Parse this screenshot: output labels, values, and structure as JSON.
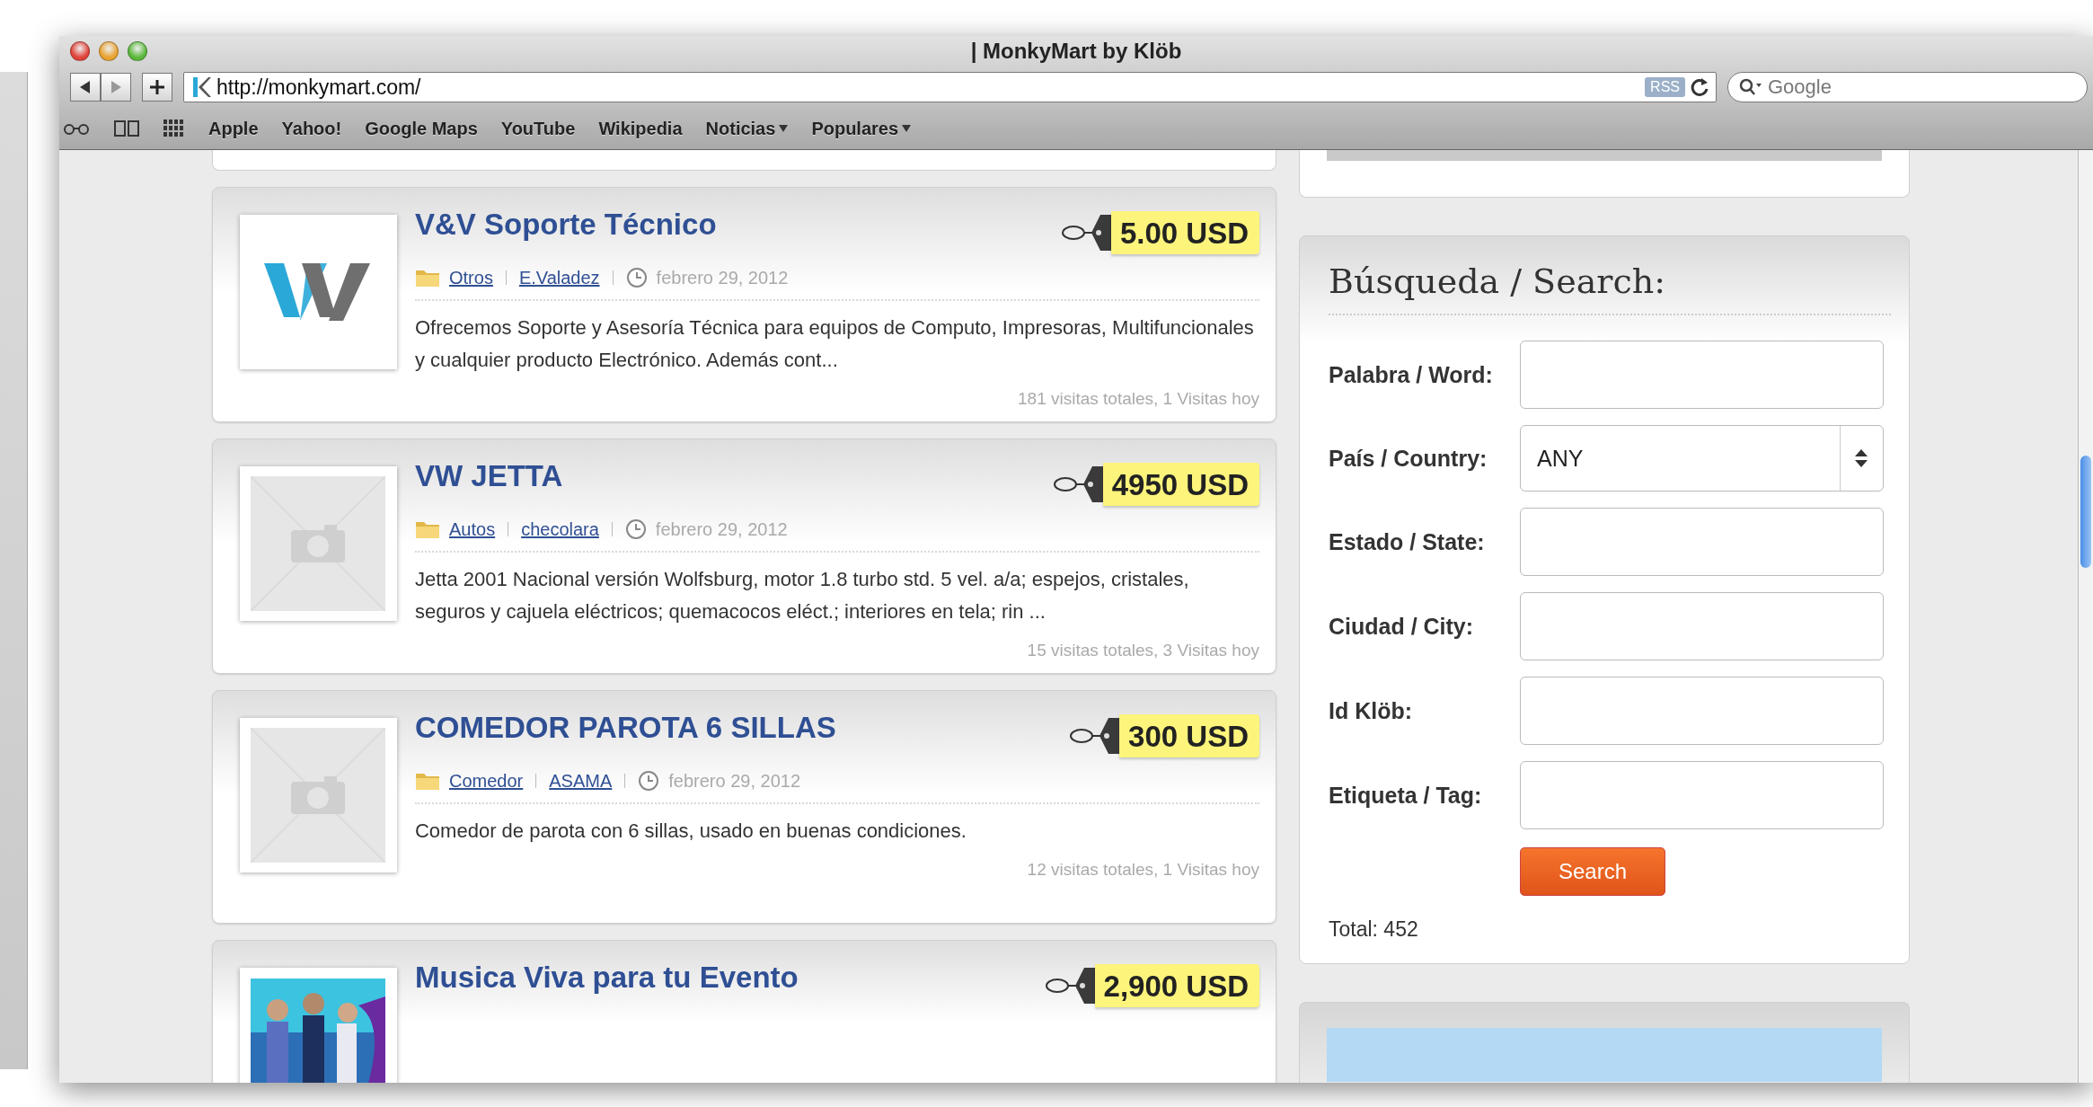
{
  "browser": {
    "title": "| MonkyMart by Klöb",
    "url": "http://monkymart.com/",
    "rss": "RSS",
    "search_placeholder": "Google",
    "bookmarks": [
      {
        "label": "Apple",
        "menu": false
      },
      {
        "label": "Yahoo!",
        "menu": false
      },
      {
        "label": "Google Maps",
        "menu": false
      },
      {
        "label": "YouTube",
        "menu": false
      },
      {
        "label": "Wikipedia",
        "menu": false
      },
      {
        "label": "Noticias",
        "menu": true
      },
      {
        "label": "Populares",
        "menu": true
      }
    ]
  },
  "listings": [
    {
      "kind": "logo",
      "title": "V&V Soporte Técnico",
      "price": "5.00 USD",
      "category": "Otros",
      "author": "E.Valadez",
      "date": "febrero 29, 2012",
      "description": "Ofrecemos Soporte y Asesoría Técnica para equipos de Computo, Impresoras, Multifuncionales y cualquier producto Electrónico. Además cont...",
      "stats": "181 visitas totales, 1 Visitas hoy"
    },
    {
      "kind": "placeholder",
      "title": "VW JETTA",
      "price": "4950 USD",
      "category": "Autos",
      "author": "checolara",
      "date": "febrero 29, 2012",
      "description": "Jetta 2001 Nacional versión Wolfsburg, motor 1.8 turbo std. 5 vel. a/a; espejos, cristales, seguros y cajuela eléctricos; quemacocos eléct.; interiores en tela; rin ...",
      "stats": "15 visitas totales, 3 Visitas hoy"
    },
    {
      "kind": "placeholder",
      "title": "COMEDOR PAROTA 6 SILLAS",
      "price": "300 USD",
      "category": "Comedor",
      "author": "ASAMA",
      "date": "febrero 29, 2012",
      "description": "Comedor de parota con 6 sillas, usado en buenas condiciones.",
      "stats": "12 visitas totales, 1 Visitas hoy"
    },
    {
      "title": "Musica Viva para tu Evento",
      "price": "2,900 USD"
    }
  ],
  "search": {
    "heading": "Búsqueda / Search:",
    "fields": [
      {
        "label": "Palabra / Word:",
        "kind": "text"
      },
      {
        "label": "País / Country:",
        "kind": "select",
        "value": "ANY"
      },
      {
        "label": "Estado / State:",
        "kind": "text"
      },
      {
        "label": "Ciudad / City:",
        "kind": "text"
      },
      {
        "label": "Id Klöb:",
        "kind": "text"
      },
      {
        "label": "Etiqueta / Tag:",
        "kind": "text"
      }
    ],
    "button": "Search",
    "total": "Total: 452"
  }
}
